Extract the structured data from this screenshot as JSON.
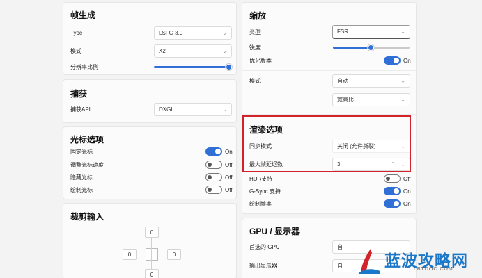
{
  "frame_gen": {
    "title": "帧生成",
    "type_label": "Type",
    "type_value": "LSFG 3.0",
    "mode_label": "模式",
    "mode_value": "X2",
    "resolution_label": "分辨率比例",
    "resolution_level": 1.0
  },
  "capture": {
    "title": "捕获",
    "api_label": "捕获API",
    "api_value": "DXGI"
  },
  "cursor": {
    "title": "光标选项",
    "items": [
      {
        "label": "固定光标",
        "state": "On",
        "on": true
      },
      {
        "label": "调整光标速度",
        "state": "Off",
        "on": false
      },
      {
        "label": "隐藏光标",
        "state": "Off",
        "on": false
      },
      {
        "label": "绘制光标",
        "state": "Off",
        "on": false
      }
    ]
  },
  "crop": {
    "title": "裁剪输入",
    "top": "0",
    "left": "0",
    "right": "0",
    "bottom": "0"
  },
  "scaling": {
    "title": "缩放",
    "type_label": "类型",
    "type_value": "FSR",
    "sharpness_label": "锐度",
    "sharpness_level": 0.5,
    "optimize_label": "优化版本",
    "optimize_state": "On",
    "mode_label": "模式",
    "mode_value": "自动",
    "aspect_value": "宽高比"
  },
  "render": {
    "title": "渲染选项",
    "sync_label": "同步模式",
    "sync_value": "关闭 (允许撕裂)",
    "max_frames_label": "最大帧延迟数",
    "max_frames_value": "3",
    "hdr_label": "HDR支持",
    "hdr_state": "Off",
    "gsync_label": "G-Sync 支持",
    "gsync_state": "On",
    "framerate_label": "绘制帧率",
    "framerate_state": "On"
  },
  "gpu": {
    "title": "GPU / 显示器",
    "preferred_label": "首选的 GPU",
    "preferred_value": "自",
    "output_label": "输出显示器",
    "output_value": "自"
  },
  "watermark": {
    "brand": "蓝波攻略网",
    "url": "LBTDOC.COM"
  },
  "colors": {
    "accent": "#2f6fd6",
    "highlight": "#d2232a",
    "watermark": "#1b77c8"
  }
}
